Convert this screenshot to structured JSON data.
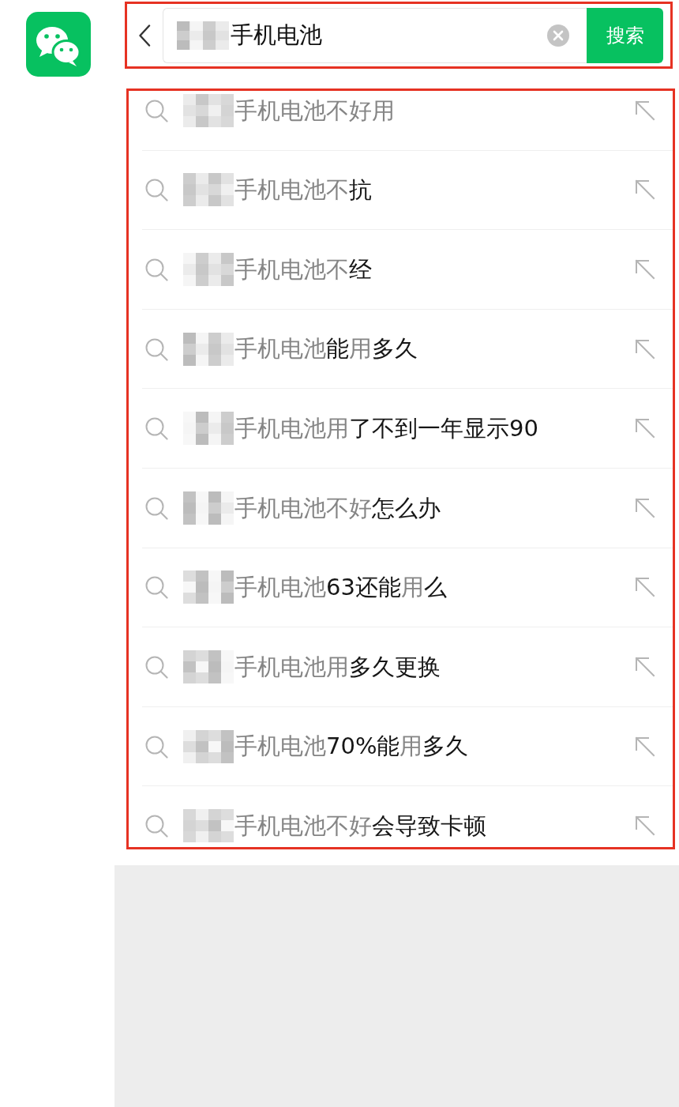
{
  "search_bar": {
    "annotated": true,
    "value": "手机电池",
    "button": "搜索"
  },
  "suggestions": {
    "annotated": true,
    "items": [
      {
        "parts": [
          {
            "text": "手机电池不好用",
            "matched": true
          }
        ]
      },
      {
        "parts": [
          {
            "text": "手机电池不",
            "matched": true
          },
          {
            "text": "抗",
            "matched": false
          }
        ]
      },
      {
        "parts": [
          {
            "text": "手机电池不",
            "matched": true
          },
          {
            "text": "经",
            "matched": false
          }
        ]
      },
      {
        "parts": [
          {
            "text": "手机电池",
            "matched": true
          },
          {
            "text": "能",
            "matched": false
          },
          {
            "text": "用",
            "matched": true
          },
          {
            "text": "多久",
            "matched": false
          }
        ]
      },
      {
        "parts": [
          {
            "text": "手机电池用",
            "matched": true
          },
          {
            "text": "了不到一年显示90",
            "matched": false
          }
        ]
      },
      {
        "parts": [
          {
            "text": "手机电池不好",
            "matched": true
          },
          {
            "text": "怎么办",
            "matched": false
          }
        ]
      },
      {
        "parts": [
          {
            "text": "手机电池",
            "matched": true
          },
          {
            "text": "63还能",
            "matched": false
          },
          {
            "text": "用",
            "matched": true
          },
          {
            "text": "么",
            "matched": false
          }
        ]
      },
      {
        "parts": [
          {
            "text": "手机电池用",
            "matched": true
          },
          {
            "text": "多久更换",
            "matched": false
          }
        ]
      },
      {
        "parts": [
          {
            "text": "手机电池",
            "matched": true
          },
          {
            "text": "70%能",
            "matched": false
          },
          {
            "text": "用",
            "matched": true
          },
          {
            "text": "多久",
            "matched": false
          }
        ]
      },
      {
        "parts": [
          {
            "text": "手机电池不好",
            "matched": true
          },
          {
            "text": "会导致卡顿",
            "matched": false
          }
        ]
      }
    ]
  }
}
